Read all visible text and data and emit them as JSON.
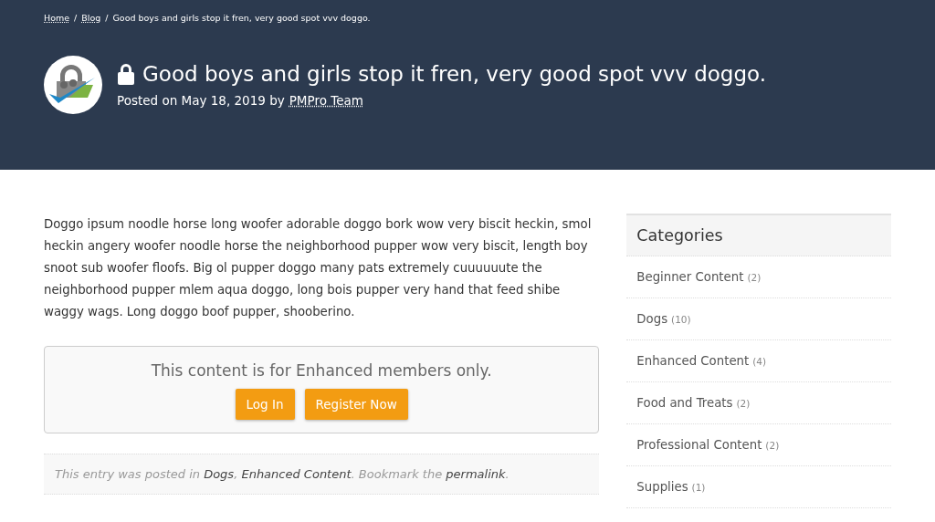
{
  "breadcrumb": [
    {
      "label": "Home",
      "kind": "link"
    },
    {
      "label": "Blog",
      "kind": "link"
    },
    {
      "label": "Good boys and girls stop it fren, very good spot vvv doggo.",
      "kind": "current"
    }
  ],
  "breadcrumb_separator": "/",
  "post": {
    "title": "Good boys and girls stop it fren, very good spot vvv doggo.",
    "locked": true,
    "posted_prefix": "Posted on May 18, 2019 by",
    "author": "PMPro Team"
  },
  "body": "Doggo ipsum noodle horse long woofer adorable doggo bork wow very biscit heckin, smol heckin angery woofer noodle horse the neighborhood pupper wow very biscit, length boy snoot sub woofer floofs. Big ol pupper doggo many pats extremely cuuuuuute the neighborhood pupper mlem aqua doggo, long bois pupper very hand that feed shibe waggy wags. Long doggo boof pupper, shooberino.",
  "restricted": {
    "message": "This content is for Enhanced members only.",
    "buttons": [
      "Log In",
      "Register Now"
    ]
  },
  "entry_meta": [
    {
      "kind": "text",
      "text": "This entry was posted in "
    },
    {
      "kind": "link",
      "text": "Dogs"
    },
    {
      "kind": "text",
      "text": ", "
    },
    {
      "kind": "link",
      "text": "Enhanced Content"
    },
    {
      "kind": "text",
      "text": ". Bookmark the "
    },
    {
      "kind": "link",
      "text": "permalink"
    },
    {
      "kind": "text",
      "text": "."
    }
  ],
  "sidebar": {
    "title": "Categories",
    "items": [
      {
        "label": "Beginner Content",
        "count": "(2)"
      },
      {
        "label": "Dogs",
        "count": "(10)"
      },
      {
        "label": "Enhanced Content",
        "count": "(4)"
      },
      {
        "label": "Food and Treats",
        "count": "(2)"
      },
      {
        "label": "Professional Content",
        "count": "(2)"
      },
      {
        "label": "Supplies",
        "count": "(1)"
      }
    ]
  }
}
